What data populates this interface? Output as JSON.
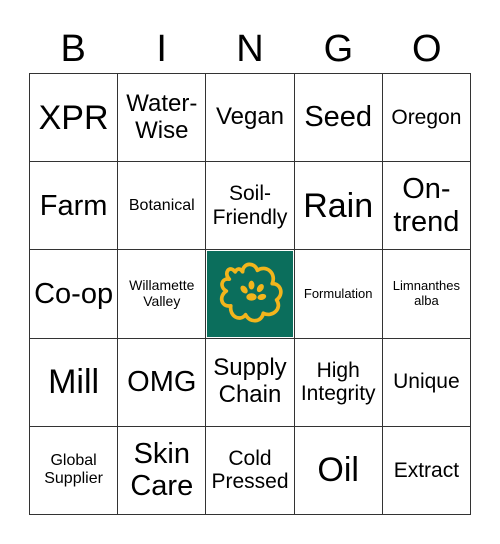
{
  "header": {
    "letters": [
      "B",
      "I",
      "N",
      "G",
      "O"
    ]
  },
  "cells": [
    "XPR",
    "Water-Wise",
    "Vegan",
    "Seed",
    "Oregon",
    "Farm",
    "Botanical",
    "Soil-Friendly",
    "Rain",
    "On-trend",
    "Co-op",
    "Willamette Valley",
    "",
    "Formulation",
    "Limnanthes alba",
    "Mill",
    "OMG",
    "Supply Chain",
    "High Integrity",
    "Unique",
    "Global Supplier",
    "Skin Care",
    "Cold Pressed",
    "Oil",
    "Extract"
  ],
  "free_space": {
    "icon": "flower-logo-icon",
    "background": "#0b6e5c",
    "foreground": "#f2b51c"
  }
}
